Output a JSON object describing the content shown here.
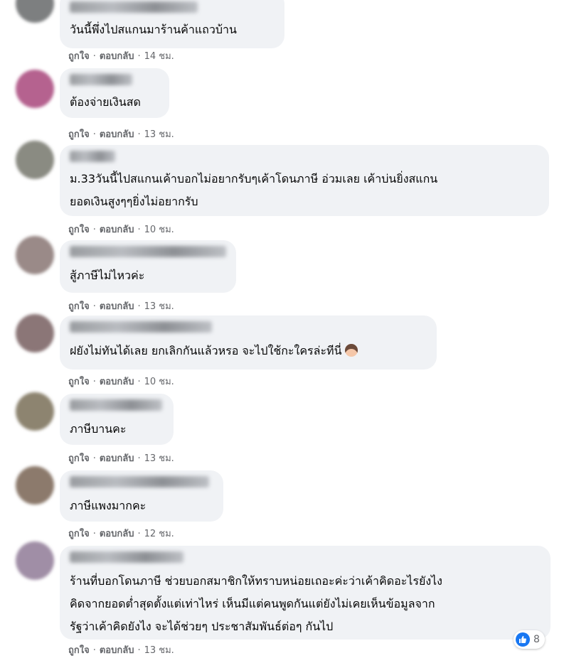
{
  "comments": [
    {
      "text": "วันนี้พึ่งไปสแกนมาร้านค้าแถวบ้าน",
      "time": "14 ชม."
    },
    {
      "text": "ต้องจ่ายเงินสด",
      "time": "13 ชม."
    },
    {
      "text": "ม.33วันนี้ไปสแกนเค้าบอกไม่อยากรับๆเค้าโดนภาษี อ่วมเลย เค้าบ่นยิ่งสแกน\nยอดเงินสูงๆๆยิ่งไม่อยากรับ",
      "time": "10 ชม."
    },
    {
      "text": "สู้ภาษีไม่ไหวค่ะ",
      "time": "13 ชม."
    },
    {
      "text": "ฝยังไม่ทันได้เลย ยกเลิกกันแล้วหรอ จะไปใช้กะใครล่ะทีนี่",
      "time": "10 ชม."
    },
    {
      "text": "ภาษีบานคะ",
      "time": "13 ชม."
    },
    {
      "text": "ภาษีแพงมากคะ",
      "time": "12 ชม."
    },
    {
      "text": "ร้านที่บอกโดนภาษี ช่วยบอกสมาชิกให้ทราบหน่อยเถอะค่ะว่าเค้าคิดอะไรยังไง\nคิดจากยอดต่ำสุดตั้งแต่เท่าไหร่ เห็นมีแต่คนพูดกันแต่ยังไม่เคยเห็นข้อมูลจาก\nรัฐว่าเค้าคิดยังไง จะได้ช่วยๆ ประชาสัมพันธ์ต่อๆ กันไป",
      "time": "13 ชม.",
      "reaction_count": "8"
    }
  ],
  "actions": {
    "like": "ถูกใจ",
    "reply": "ตอบกลับ",
    "separator": "·"
  },
  "icons": {
    "like": "like-icon",
    "emoji": "person-emoji-icon"
  },
  "colors": {
    "bubble": "#f0f2f5",
    "meta": "#65676b",
    "text": "#050505",
    "like": "#1877f2"
  }
}
